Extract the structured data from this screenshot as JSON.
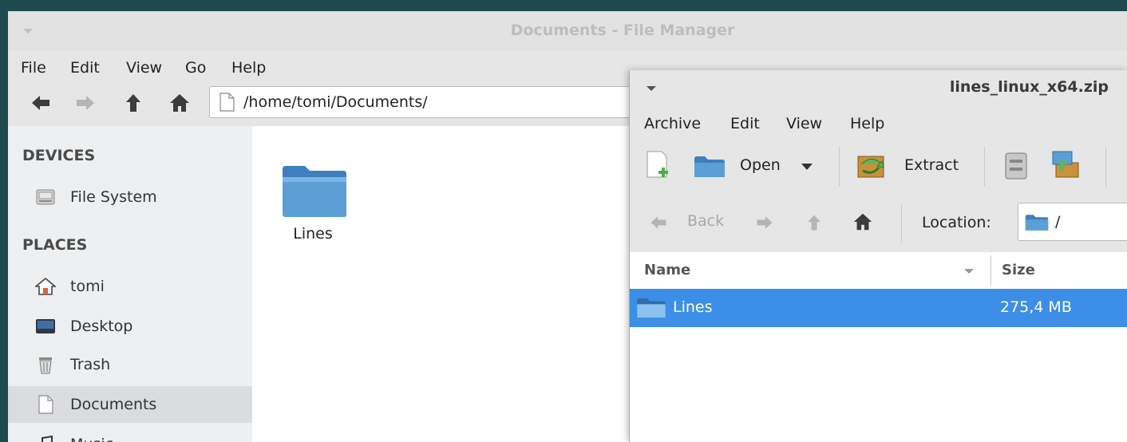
{
  "file_manager": {
    "title": "Documents - File Manager",
    "menu": [
      "File",
      "Edit",
      "View",
      "Go",
      "Help"
    ],
    "path": "/home/tomi/Documents/",
    "sidebar": {
      "devices_heading": "DEVICES",
      "devices": [
        {
          "label": "File System",
          "icon": "drive-icon"
        }
      ],
      "places_heading": "PLACES",
      "places": [
        {
          "label": "tomi",
          "icon": "home-icon"
        },
        {
          "label": "Desktop",
          "icon": "desktop-icon"
        },
        {
          "label": "Trash",
          "icon": "trash-icon"
        },
        {
          "label": "Documents",
          "icon": "document-icon",
          "selected": true
        },
        {
          "label": "Music",
          "icon": "music-icon"
        }
      ]
    },
    "items": [
      {
        "label": "Lines",
        "icon": "folder-icon"
      }
    ]
  },
  "archive_manager": {
    "title": "lines_linux_x64.zip",
    "menu": [
      "Archive",
      "Edit",
      "View",
      "Help"
    ],
    "toolbar": {
      "open_label": "Open",
      "extract_label": "Extract"
    },
    "nav": {
      "back_label": "Back",
      "location_label": "Location:",
      "location_value": "/"
    },
    "columns": {
      "name": "Name",
      "size": "Size"
    },
    "rows": [
      {
        "name": "Lines",
        "size": "275,4 MB",
        "selected": true
      }
    ]
  },
  "colors": {
    "selection": "#3d8ee6",
    "folder": "#5b9fd6"
  }
}
